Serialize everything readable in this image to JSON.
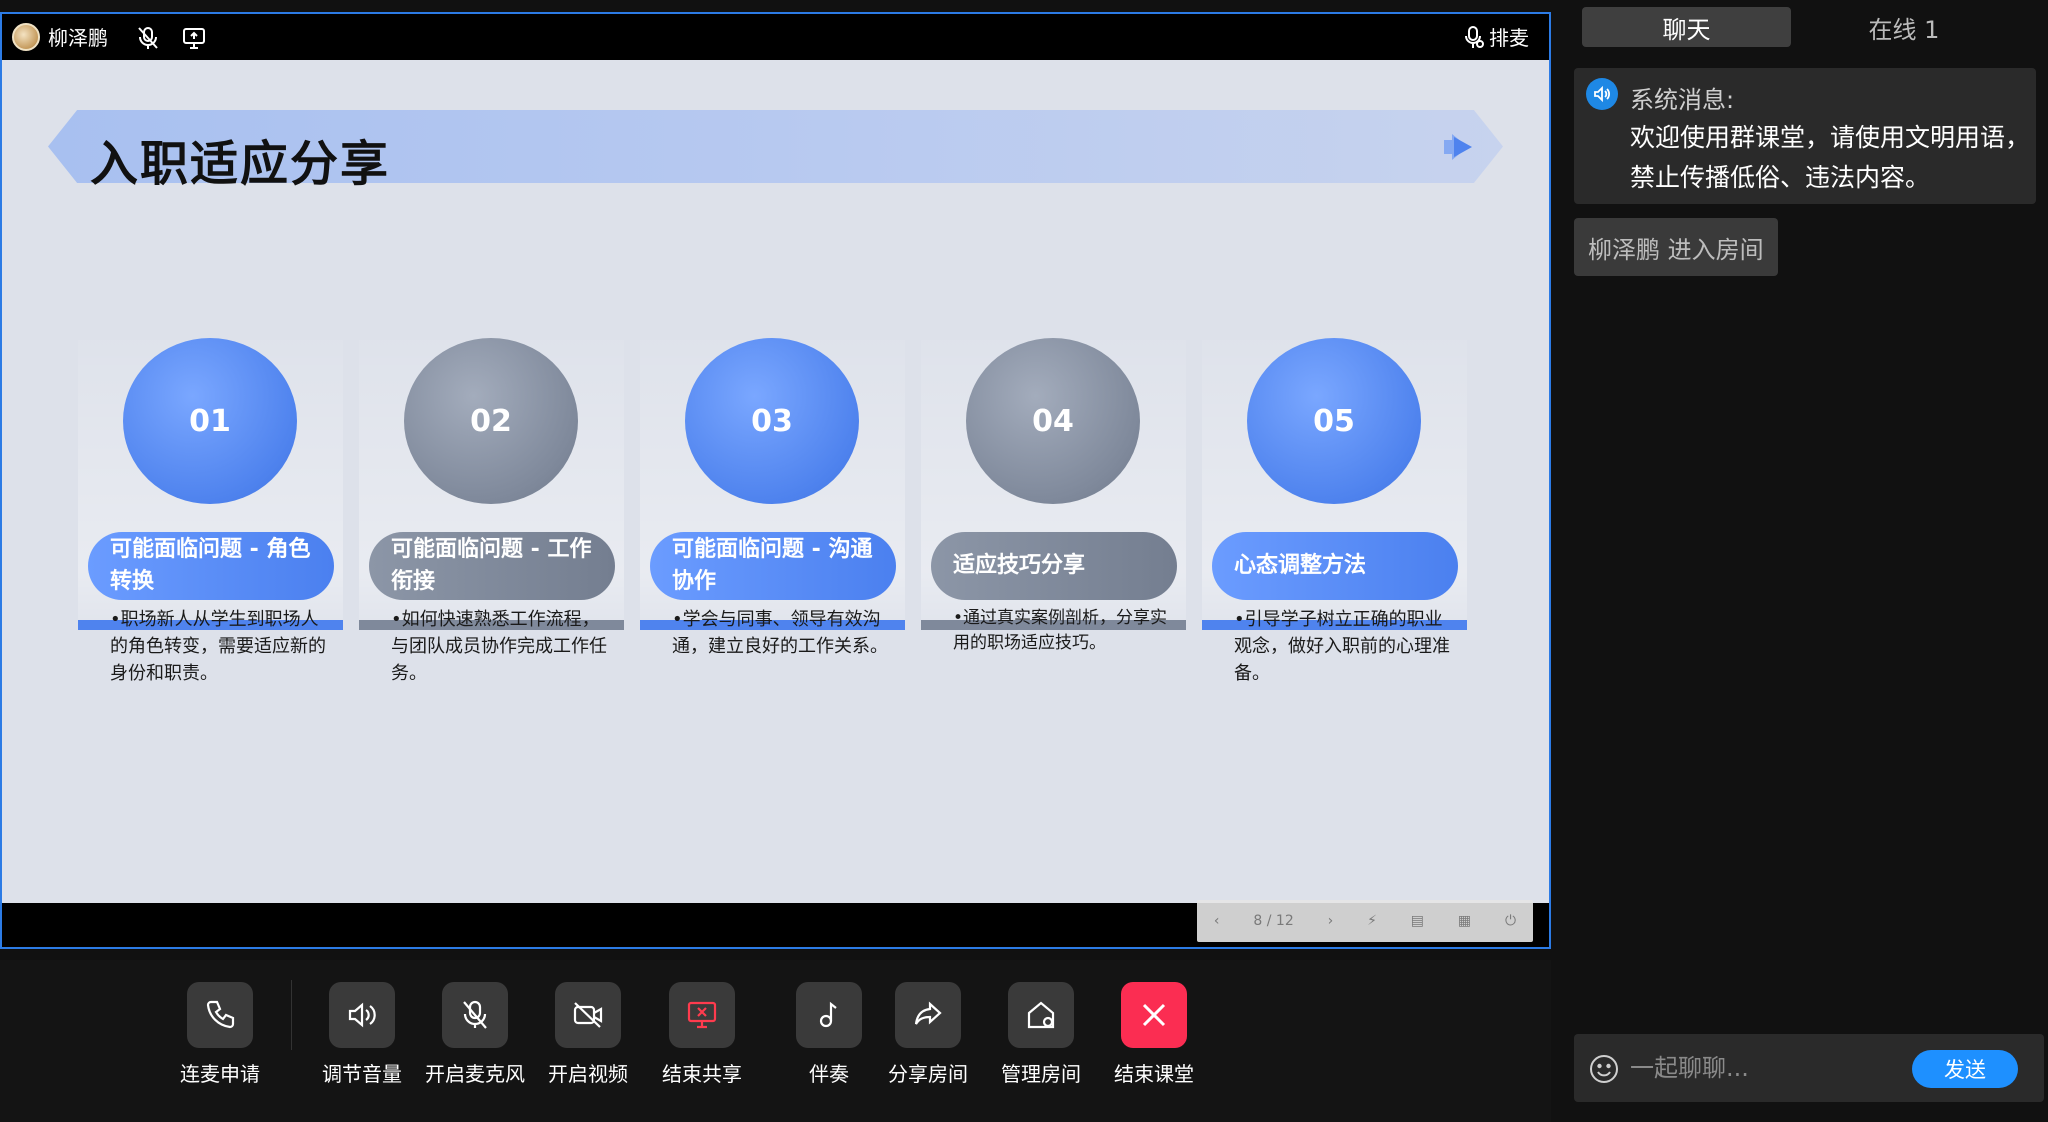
{
  "stage": {
    "user_name": "柳泽鹏",
    "queue_label": "排麦"
  },
  "slide": {
    "title": "入职适应分享",
    "items": [
      {
        "num": "01",
        "heading": "可能面临问题 - 角色转换",
        "desc": "•职场新人从学生到职场人的角色转变，需要适应新的身份和职责。",
        "color": "blue"
      },
      {
        "num": "02",
        "heading": "可能面临问题 - 工作衔接",
        "desc": "•如何快速熟悉工作流程，与团队成员协作完成工作任务。",
        "color": "gray"
      },
      {
        "num": "03",
        "heading": "可能面临问题 - 沟通协作",
        "desc": "•学会与同事、领导有效沟通，建立良好的工作关系。",
        "color": "blue"
      },
      {
        "num": "04",
        "heading": "适应技巧分享",
        "desc": "•通过真实案例剖析，分享实用的职场适应技巧。",
        "color": "gray"
      },
      {
        "num": "05",
        "heading": "心态调整方法",
        "desc": "•引导学子树立正确的职业观念，做好入职前的心理准备。",
        "color": "blue"
      }
    ],
    "page_indicator": "8 / 12"
  },
  "toolbar": {
    "apply_mic": "连麦申请",
    "volume": "调节音量",
    "open_mic": "开启麦克风",
    "open_video": "开启视频",
    "end_share": "结束共享",
    "accompany": "伴奏",
    "share_room": "分享房间",
    "manage_room": "管理房间",
    "end_class": "结束课堂"
  },
  "chat": {
    "tab_chat": "聊天",
    "tab_online": "在线 1",
    "system_title": "系统消息:",
    "system_text": "欢迎使用群课堂，请使用文明用语，禁止传播低俗、违法内容。",
    "enter_msg": "柳泽鹏 进入房间",
    "input_placeholder": "一起聊聊...",
    "send_label": "发送"
  },
  "colors": {
    "accent_blue": "#4f83ee",
    "gray": "#7f899b",
    "end_red": "#fb2d52",
    "send_blue": "#1e90ff"
  }
}
